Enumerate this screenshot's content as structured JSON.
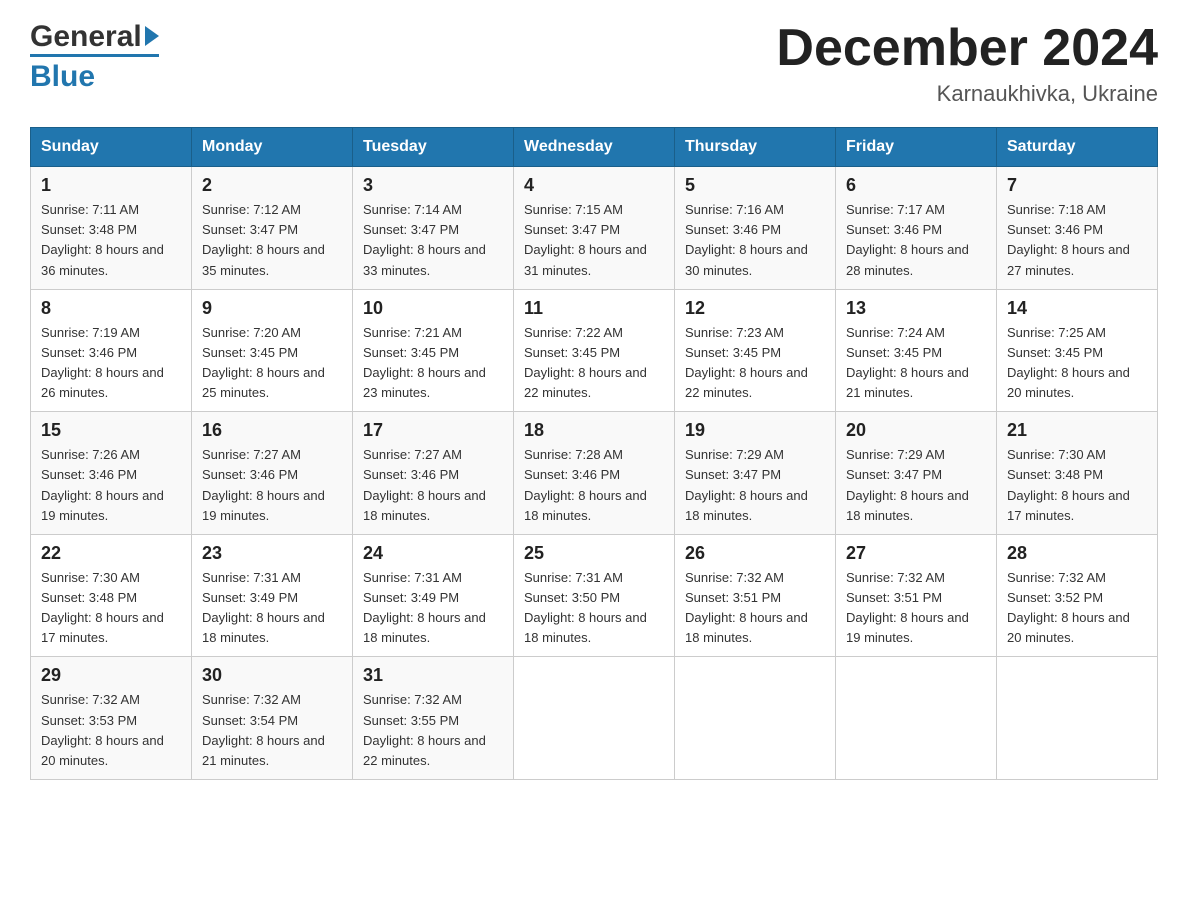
{
  "header": {
    "logo": {
      "name_top": "General",
      "name_bottom": "Blue"
    },
    "title": "December 2024",
    "location": "Karnaukhivka, Ukraine"
  },
  "days_of_week": [
    "Sunday",
    "Monday",
    "Tuesday",
    "Wednesday",
    "Thursday",
    "Friday",
    "Saturday"
  ],
  "weeks": [
    [
      {
        "day": "1",
        "sunrise": "7:11 AM",
        "sunset": "3:48 PM",
        "daylight": "8 hours and 36 minutes."
      },
      {
        "day": "2",
        "sunrise": "7:12 AM",
        "sunset": "3:47 PM",
        "daylight": "8 hours and 35 minutes."
      },
      {
        "day": "3",
        "sunrise": "7:14 AM",
        "sunset": "3:47 PM",
        "daylight": "8 hours and 33 minutes."
      },
      {
        "day": "4",
        "sunrise": "7:15 AM",
        "sunset": "3:47 PM",
        "daylight": "8 hours and 31 minutes."
      },
      {
        "day": "5",
        "sunrise": "7:16 AM",
        "sunset": "3:46 PM",
        "daylight": "8 hours and 30 minutes."
      },
      {
        "day": "6",
        "sunrise": "7:17 AM",
        "sunset": "3:46 PM",
        "daylight": "8 hours and 28 minutes."
      },
      {
        "day": "7",
        "sunrise": "7:18 AM",
        "sunset": "3:46 PM",
        "daylight": "8 hours and 27 minutes."
      }
    ],
    [
      {
        "day": "8",
        "sunrise": "7:19 AM",
        "sunset": "3:46 PM",
        "daylight": "8 hours and 26 minutes."
      },
      {
        "day": "9",
        "sunrise": "7:20 AM",
        "sunset": "3:45 PM",
        "daylight": "8 hours and 25 minutes."
      },
      {
        "day": "10",
        "sunrise": "7:21 AM",
        "sunset": "3:45 PM",
        "daylight": "8 hours and 23 minutes."
      },
      {
        "day": "11",
        "sunrise": "7:22 AM",
        "sunset": "3:45 PM",
        "daylight": "8 hours and 22 minutes."
      },
      {
        "day": "12",
        "sunrise": "7:23 AM",
        "sunset": "3:45 PM",
        "daylight": "8 hours and 22 minutes."
      },
      {
        "day": "13",
        "sunrise": "7:24 AM",
        "sunset": "3:45 PM",
        "daylight": "8 hours and 21 minutes."
      },
      {
        "day": "14",
        "sunrise": "7:25 AM",
        "sunset": "3:45 PM",
        "daylight": "8 hours and 20 minutes."
      }
    ],
    [
      {
        "day": "15",
        "sunrise": "7:26 AM",
        "sunset": "3:46 PM",
        "daylight": "8 hours and 19 minutes."
      },
      {
        "day": "16",
        "sunrise": "7:27 AM",
        "sunset": "3:46 PM",
        "daylight": "8 hours and 19 minutes."
      },
      {
        "day": "17",
        "sunrise": "7:27 AM",
        "sunset": "3:46 PM",
        "daylight": "8 hours and 18 minutes."
      },
      {
        "day": "18",
        "sunrise": "7:28 AM",
        "sunset": "3:46 PM",
        "daylight": "8 hours and 18 minutes."
      },
      {
        "day": "19",
        "sunrise": "7:29 AM",
        "sunset": "3:47 PM",
        "daylight": "8 hours and 18 minutes."
      },
      {
        "day": "20",
        "sunrise": "7:29 AM",
        "sunset": "3:47 PM",
        "daylight": "8 hours and 18 minutes."
      },
      {
        "day": "21",
        "sunrise": "7:30 AM",
        "sunset": "3:48 PM",
        "daylight": "8 hours and 17 minutes."
      }
    ],
    [
      {
        "day": "22",
        "sunrise": "7:30 AM",
        "sunset": "3:48 PM",
        "daylight": "8 hours and 17 minutes."
      },
      {
        "day": "23",
        "sunrise": "7:31 AM",
        "sunset": "3:49 PM",
        "daylight": "8 hours and 18 minutes."
      },
      {
        "day": "24",
        "sunrise": "7:31 AM",
        "sunset": "3:49 PM",
        "daylight": "8 hours and 18 minutes."
      },
      {
        "day": "25",
        "sunrise": "7:31 AM",
        "sunset": "3:50 PM",
        "daylight": "8 hours and 18 minutes."
      },
      {
        "day": "26",
        "sunrise": "7:32 AM",
        "sunset": "3:51 PM",
        "daylight": "8 hours and 18 minutes."
      },
      {
        "day": "27",
        "sunrise": "7:32 AM",
        "sunset": "3:51 PM",
        "daylight": "8 hours and 19 minutes."
      },
      {
        "day": "28",
        "sunrise": "7:32 AM",
        "sunset": "3:52 PM",
        "daylight": "8 hours and 20 minutes."
      }
    ],
    [
      {
        "day": "29",
        "sunrise": "7:32 AM",
        "sunset": "3:53 PM",
        "daylight": "8 hours and 20 minutes."
      },
      {
        "day": "30",
        "sunrise": "7:32 AM",
        "sunset": "3:54 PM",
        "daylight": "8 hours and 21 minutes."
      },
      {
        "day": "31",
        "sunrise": "7:32 AM",
        "sunset": "3:55 PM",
        "daylight": "8 hours and 22 minutes."
      },
      null,
      null,
      null,
      null
    ]
  ]
}
